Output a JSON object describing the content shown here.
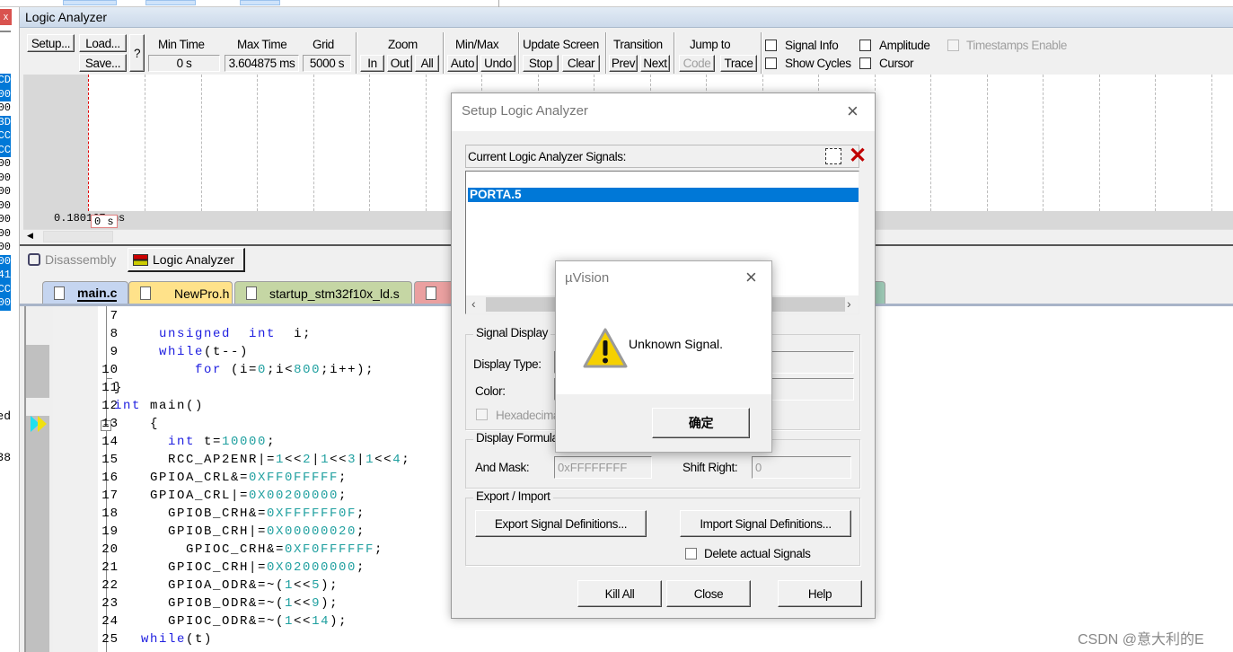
{
  "left_strip": {
    "hex_rows": [
      {
        "t": "CD",
        "sel": true
      },
      {
        "t": "00",
        "sel": true
      },
      {
        "t": "00",
        "sel": false
      },
      {
        "t": "3D",
        "sel": true
      },
      {
        "t": "CC",
        "sel": true
      },
      {
        "t": "CC",
        "sel": true
      },
      {
        "t": "00",
        "sel": false
      },
      {
        "t": "00",
        "sel": false
      },
      {
        "t": "00",
        "sel": false
      },
      {
        "t": "00",
        "sel": false
      },
      {
        "t": "00",
        "sel": false
      },
      {
        "t": "00",
        "sel": false
      },
      {
        "t": "00",
        "sel": false
      },
      {
        "t": "00",
        "sel": true
      },
      {
        "t": "41",
        "sel": true
      },
      {
        "t": "CC",
        "sel": true
      },
      {
        "t": "00",
        "sel": true
      }
    ],
    "frag1": "ed",
    "frag2": "38"
  },
  "logic_analyzer": {
    "title": "Logic Analyzer",
    "toolbar": {
      "setup": "Setup...",
      "load": "Load...",
      "save": "Save...",
      "help": "?",
      "min_time_label": "Min Time",
      "min_time": "0 s",
      "max_time_label": "Max Time",
      "max_time": "3.604875 ms",
      "grid_label": "Grid",
      "grid": "5000 s",
      "zoom_label": "Zoom",
      "zoom_in": "In",
      "zoom_out": "Out",
      "zoom_all": "All",
      "minmax_label": "Min/Max",
      "auto": "Auto",
      "undo": "Undo",
      "update_label": "Update Screen",
      "stop": "Stop",
      "clear": "Clear",
      "transition_label": "Transition",
      "prev": "Prev",
      "next": "Next",
      "jump_label": "Jump to",
      "code": "Code",
      "trace": "Trace",
      "signal_info": "Signal Info",
      "show_cycles": "Show Cycles",
      "amplitude": "Amplitude",
      "cursor": "Cursor",
      "timestamps": "Timestamps Enable"
    },
    "time_readout": "0.180167 ms",
    "cursor_readout": "0 s"
  },
  "bottom_tabs": [
    {
      "label": "Disassembly",
      "active": false
    },
    {
      "label": "Logic Analyzer",
      "active": true
    }
  ],
  "file_tabs": [
    {
      "label": "main.c",
      "color": "#c5d5f0",
      "active": true
    },
    {
      "label": "NewPro.h",
      "color": "#ffe28a"
    },
    {
      "label": "startup_stm32f10x_ld.s",
      "color": "#c5d6a4"
    },
    {
      "label": "",
      "color": "#eaa0a0"
    }
  ],
  "editor": {
    "lines": [
      {
        "n": "7",
        "tokens": []
      },
      {
        "n": "8",
        "tokens": [
          [
            "     ",
            ""
          ],
          [
            "unsigned",
            "kw"
          ],
          [
            "  ",
            ""
          ],
          [
            "int",
            "kw"
          ],
          [
            "  i;",
            ""
          ]
        ]
      },
      {
        "n": "9",
        "tokens": [
          [
            "     ",
            ""
          ],
          [
            "while",
            "kw"
          ],
          [
            "(t--)",
            ""
          ]
        ]
      },
      {
        "n": "10",
        "tokens": [
          [
            "         ",
            ""
          ],
          [
            "for",
            "kw"
          ],
          [
            " (i=",
            ""
          ],
          [
            "0",
            "num"
          ],
          [
            ";i<",
            ""
          ],
          [
            "800",
            "num"
          ],
          [
            ";i++);",
            ""
          ]
        ]
      },
      {
        "n": "11",
        "tokens": [
          [
            "}",
            ""
          ]
        ]
      },
      {
        "n": "12",
        "tokens": [
          [
            "int",
            "kw"
          ],
          [
            " main()",
            ""
          ]
        ]
      },
      {
        "n": "13",
        "tokens": [
          [
            "    {",
            ""
          ]
        ]
      },
      {
        "n": "14",
        "tokens": [
          [
            "      ",
            ""
          ],
          [
            "int",
            "kw"
          ],
          [
            " t=",
            ""
          ],
          [
            "10000",
            "num"
          ],
          [
            ";",
            ""
          ]
        ]
      },
      {
        "n": "15",
        "tokens": [
          [
            "      RCC_AP2ENR|=",
            ""
          ],
          [
            "1",
            "num"
          ],
          [
            "<<",
            ""
          ],
          [
            "2",
            "num"
          ],
          [
            "|",
            ""
          ],
          [
            "1",
            "num"
          ],
          [
            "<<",
            ""
          ],
          [
            "3",
            "num"
          ],
          [
            "|",
            ""
          ],
          [
            "1",
            "num"
          ],
          [
            "<<",
            ""
          ],
          [
            "4",
            "num"
          ],
          [
            ";",
            ""
          ]
        ]
      },
      {
        "n": "16",
        "tokens": [
          [
            "    GPIOA_CRL&=",
            ""
          ],
          [
            "0XFF0FFFFF",
            "num"
          ],
          [
            ";",
            ""
          ]
        ]
      },
      {
        "n": "17",
        "tokens": [
          [
            "    GPIOA_CRL|=",
            ""
          ],
          [
            "0X00200000",
            "num"
          ],
          [
            ";",
            ""
          ]
        ]
      },
      {
        "n": "18",
        "tokens": [
          [
            "      GPIOB_CRH&=",
            ""
          ],
          [
            "0XFFFFFF0F",
            "num"
          ],
          [
            ";",
            ""
          ]
        ]
      },
      {
        "n": "19",
        "tokens": [
          [
            "      GPIOB_CRH|=",
            ""
          ],
          [
            "0X00000020",
            "num"
          ],
          [
            ";",
            ""
          ]
        ]
      },
      {
        "n": "20",
        "tokens": [
          [
            "        GPIOC_CRH&=",
            ""
          ],
          [
            "0XF0FFFFFF",
            "num"
          ],
          [
            ";",
            ""
          ]
        ]
      },
      {
        "n": "21",
        "tokens": [
          [
            "      GPIOC_CRH|=",
            ""
          ],
          [
            "0X02000000",
            "num"
          ],
          [
            ";",
            ""
          ]
        ]
      },
      {
        "n": "22",
        "tokens": [
          [
            "      GPIOA_ODR&=~(",
            ""
          ],
          [
            "1",
            "num"
          ],
          [
            "<<",
            ""
          ],
          [
            "5",
            "num"
          ],
          [
            ");",
            ""
          ]
        ]
      },
      {
        "n": "23",
        "tokens": [
          [
            "      GPIOB_ODR&=~(",
            ""
          ],
          [
            "1",
            "num"
          ],
          [
            "<<",
            ""
          ],
          [
            "9",
            "num"
          ],
          [
            ");",
            ""
          ]
        ]
      },
      {
        "n": "24",
        "tokens": [
          [
            "      GPIOC_ODR&=~(",
            ""
          ],
          [
            "1",
            "num"
          ],
          [
            "<<",
            ""
          ],
          [
            "14",
            "num"
          ],
          [
            ");",
            ""
          ]
        ]
      },
      {
        "n": "25",
        "tokens": [
          [
            "   ",
            ""
          ],
          [
            "while",
            "kw"
          ],
          [
            "(t)",
            ""
          ]
        ]
      }
    ]
  },
  "setup_dialog": {
    "title": "Setup Logic Analyzer",
    "signals_label": "Current Logic Analyzer Signals:",
    "signals": [
      "PORTA.5"
    ],
    "signal_display_group": "Signal Display",
    "display_type_label": "Display Type:",
    "color_label": "Color:",
    "hexadecimal_label": "Hexadecimal Display",
    "formula_group": "Display Formula",
    "and_mask_label": "And Mask:",
    "and_mask": "0xFFFFFFFF",
    "shift_right_label": "Shift Right:",
    "shift_right": "0",
    "export_group": "Export / Import",
    "export_btn": "Export Signal Definitions...",
    "import_btn": "Import Signal Definitions...",
    "delete_label": "Delete actual Signals",
    "kill_all": "Kill All",
    "close": "Close",
    "help": "Help"
  },
  "message_box": {
    "title": "µVision",
    "message": "Unknown Signal.",
    "ok": "确定",
    "icon": "warning-icon"
  },
  "watermark": "CSDN @意大利的E"
}
